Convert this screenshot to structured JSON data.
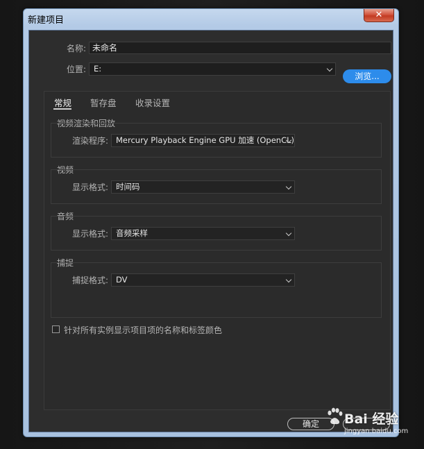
{
  "window": {
    "title": "新建项目",
    "close_glyph": "✕"
  },
  "form": {
    "name_label": "名称:",
    "name_value": "未命名",
    "location_label": "位置:",
    "location_value": "E:",
    "browse_label": "浏览..."
  },
  "tabs": [
    {
      "label": "常规",
      "active": true
    },
    {
      "label": "暂存盘",
      "active": false
    },
    {
      "label": "收录设置",
      "active": false
    }
  ],
  "groups": {
    "render": {
      "title": "视频渲染和回放",
      "field_label": "渲染程序:",
      "field_value": "Mercury Playback Engine GPU 加速 (OpenCL)"
    },
    "video": {
      "title": "视频",
      "field_label": "显示格式:",
      "field_value": "时间码"
    },
    "audio": {
      "title": "音频",
      "field_label": "显示格式:",
      "field_value": "音频采样"
    },
    "capture": {
      "title": "捕捉",
      "field_label": "捕捉格式:",
      "field_value": "DV"
    }
  },
  "checkbox": {
    "label": "针对所有实例显示项目项的名称和标签颜色",
    "checked": false
  },
  "footer": {
    "ok_label": "确定"
  },
  "watermark": {
    "text": "Bai 经验",
    "url": "jingyan.baidu.com"
  },
  "colors": {
    "accent": "#2d8ceb",
    "panel_bg": "#2d2d2d",
    "title_bar": "#b3cae6",
    "close_red": "#c23a22"
  }
}
